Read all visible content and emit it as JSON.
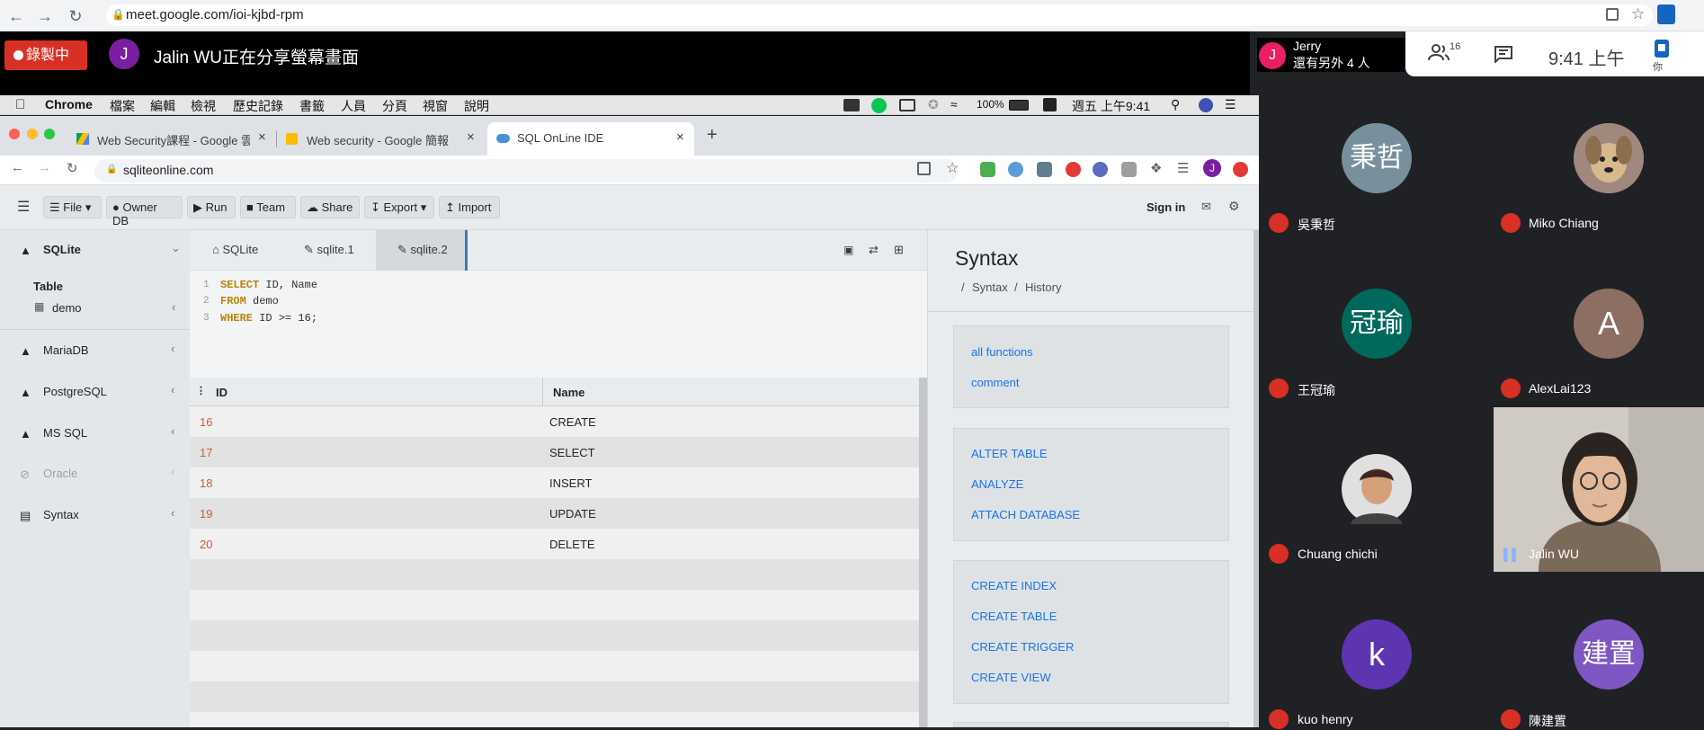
{
  "outer_browser": {
    "url": "meet.google.com/ioi-kjbd-rpm"
  },
  "meet": {
    "recording_label": "錄製中",
    "sharer_initial": "J",
    "sharing_text": "Jalin WU正在分享螢幕畫面",
    "pinned_name": "Jerry",
    "pinned_initial": "J",
    "others_text": "還有另外 4 人",
    "people_count": "16",
    "clock": "9:41 上午",
    "self_label": "你",
    "participants": [
      {
        "name": "吳秉哲",
        "initial": "秉哲",
        "color": "#78909c"
      },
      {
        "name": "Miko Chiang",
        "initial": "",
        "color": "#8d6e63"
      },
      {
        "name": "王冠瑜",
        "initial": "冠瑜",
        "color": "#00695c"
      },
      {
        "name": "AlexLai123",
        "initial": "A",
        "color": "#8d6e63"
      },
      {
        "name": "Chuang chichi",
        "initial": "",
        "color": "#5d4037"
      },
      {
        "name": "Jalin WU",
        "initial": "",
        "color": "#9e9e9e"
      },
      {
        "name": "kuo henry",
        "initial": "k",
        "color": "#5e35b1"
      },
      {
        "name": "陳建置",
        "initial": "建置",
        "color": "#7e57c2"
      }
    ]
  },
  "mac_menu": {
    "items": [
      "Chrome",
      "檔案",
      "編輯",
      "檢視",
      "歷史記錄",
      "書籤",
      "人員",
      "分頁",
      "視窗",
      "說明"
    ],
    "battery": "100%",
    "datetime": "週五 上午9:41"
  },
  "inner_browser": {
    "tabs": [
      "Web Security課程 - Google 雲端",
      "Web security - Google 簡報",
      "SQL OnLine IDE"
    ],
    "url": "sqliteonline.com",
    "profile_initial": "J"
  },
  "app": {
    "toolbar": {
      "file": "File",
      "owner_db": "Owner DB",
      "run": "Run",
      "team": "Team",
      "share": "Share",
      "export": "Export",
      "import": "Import",
      "sign_in": "Sign in"
    },
    "sidebar": {
      "sqlite": "SQLite",
      "table_header": "Table",
      "table_item": "demo",
      "dbs": [
        "MariaDB",
        "PostgreSQL",
        "MS SQL",
        "Oracle",
        "Syntax"
      ]
    },
    "editor_tabs": [
      "SQLite",
      "sqlite.1",
      "sqlite.2"
    ],
    "code": {
      "line1_kw": "SELECT",
      "line1_rest": " ID, Name",
      "line2_kw": "FROM",
      "line2_rest": " demo",
      "line3_kw": "WHERE",
      "line3_rest": " ID >= 16;",
      "ln1": "1",
      "ln2": "2",
      "ln3": "3"
    },
    "result": {
      "columns": [
        "ID",
        "Name"
      ],
      "rows": [
        {
          "id": "16",
          "name": "CREATE"
        },
        {
          "id": "17",
          "name": "SELECT"
        },
        {
          "id": "18",
          "name": "INSERT"
        },
        {
          "id": "19",
          "name": "UPDATE"
        },
        {
          "id": "20",
          "name": "DELETE"
        }
      ]
    },
    "syntax": {
      "title": "Syntax",
      "crumbs": [
        "Syntax",
        "History"
      ],
      "group1": [
        "all functions",
        "comment"
      ],
      "group2": [
        "ALTER TABLE",
        "ANALYZE",
        "ATTACH DATABASE"
      ],
      "group3": [
        "CREATE INDEX",
        "CREATE TABLE",
        "CREATE TRIGGER",
        "CREATE VIEW"
      ]
    }
  }
}
